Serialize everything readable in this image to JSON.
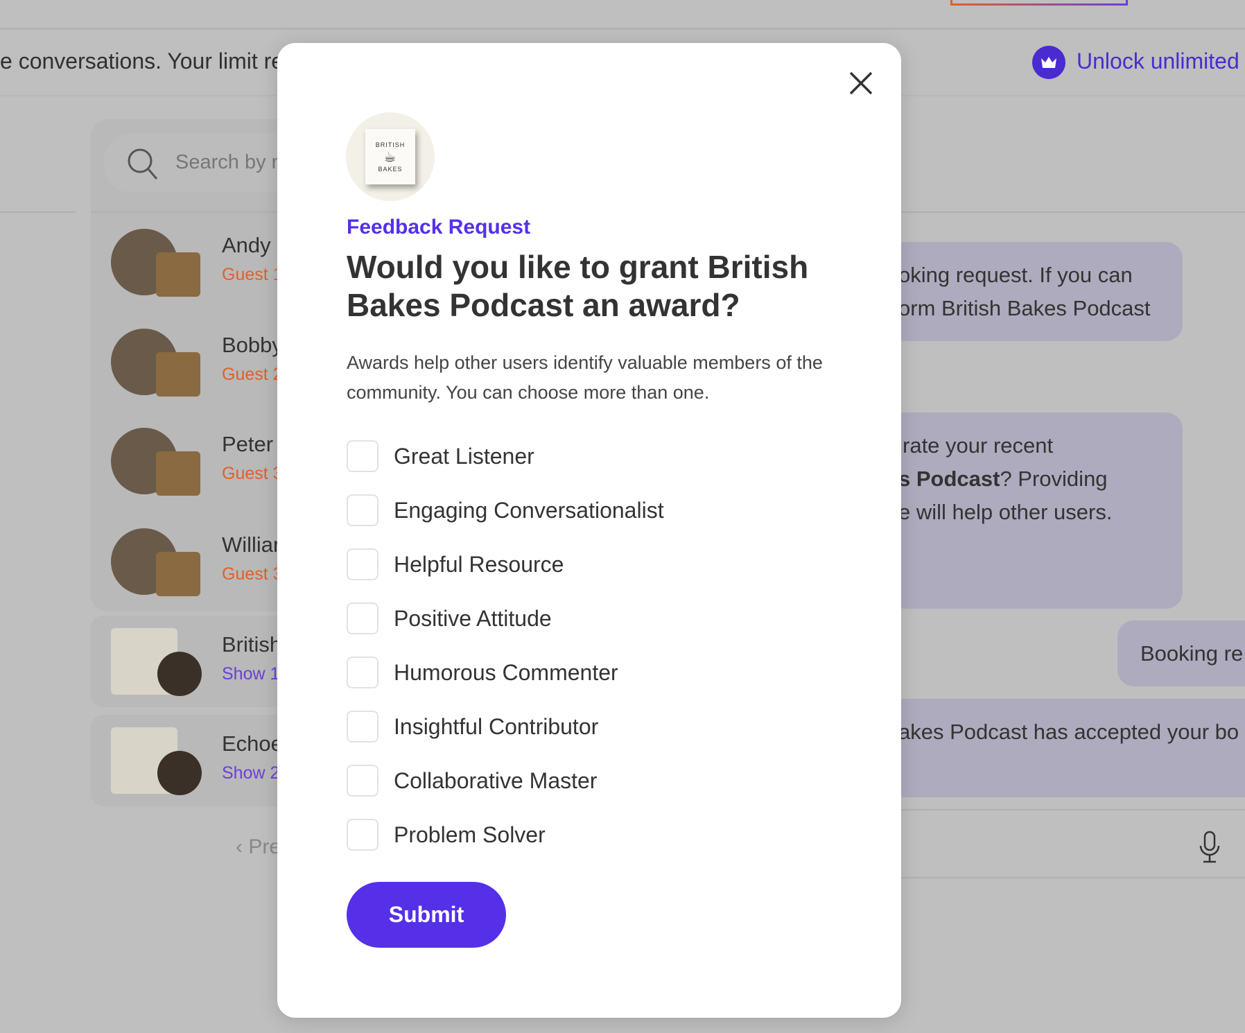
{
  "banner": {
    "limit_text": "e conversations. Your limit re",
    "unlock_label": "Unlock unlimited",
    "icon": "crown-icon"
  },
  "sidebar": {
    "search_placeholder": "Search by n",
    "items": [
      {
        "name": "Andy",
        "sub": "Guest 1",
        "type": "guest"
      },
      {
        "name": "Bobby",
        "sub": "Guest 2",
        "type": "guest"
      },
      {
        "name": "Peter",
        "sub": "Guest 3",
        "type": "guest"
      },
      {
        "name": "Willian",
        "sub": "Guest 3",
        "type": "guest"
      },
      {
        "name": "British",
        "sub": "Show 1",
        "type": "show"
      },
      {
        "name": "Echoe",
        "sub": "Show 2",
        "type": "show"
      }
    ],
    "prev_label": "‹ Pre"
  },
  "chat": {
    "b1": [
      "oking request. If you can",
      "orm British Bakes Podcast"
    ],
    "b2": {
      "l1": "rate your recent",
      "l2_bold": "s Podcast",
      "l2_rest": "? Providing",
      "l3": "e will help other users."
    },
    "b3": "Booking re",
    "b4": "akes Podcast has accepted your bo"
  },
  "modal": {
    "logo_text": [
      "BRITISH",
      "BAKES"
    ],
    "kicker": "Feedback Request",
    "title": "Would you like to grant British Bakes Podcast an award?",
    "description": "Awards help other users identify valuable members of the community. You can choose more than one.",
    "options": [
      "Great Listener",
      "Engaging Conversationalist",
      "Helpful Resource",
      "Positive Attitude",
      "Humorous Commenter",
      "Insightful Contributor",
      "Collaborative Master",
      "Problem Solver"
    ],
    "submit_label": "Submit"
  },
  "colors": {
    "accent": "#5530e8",
    "guest": "#e0602a",
    "show": "#6b3fd8",
    "overlay": "#bfbfbf"
  }
}
